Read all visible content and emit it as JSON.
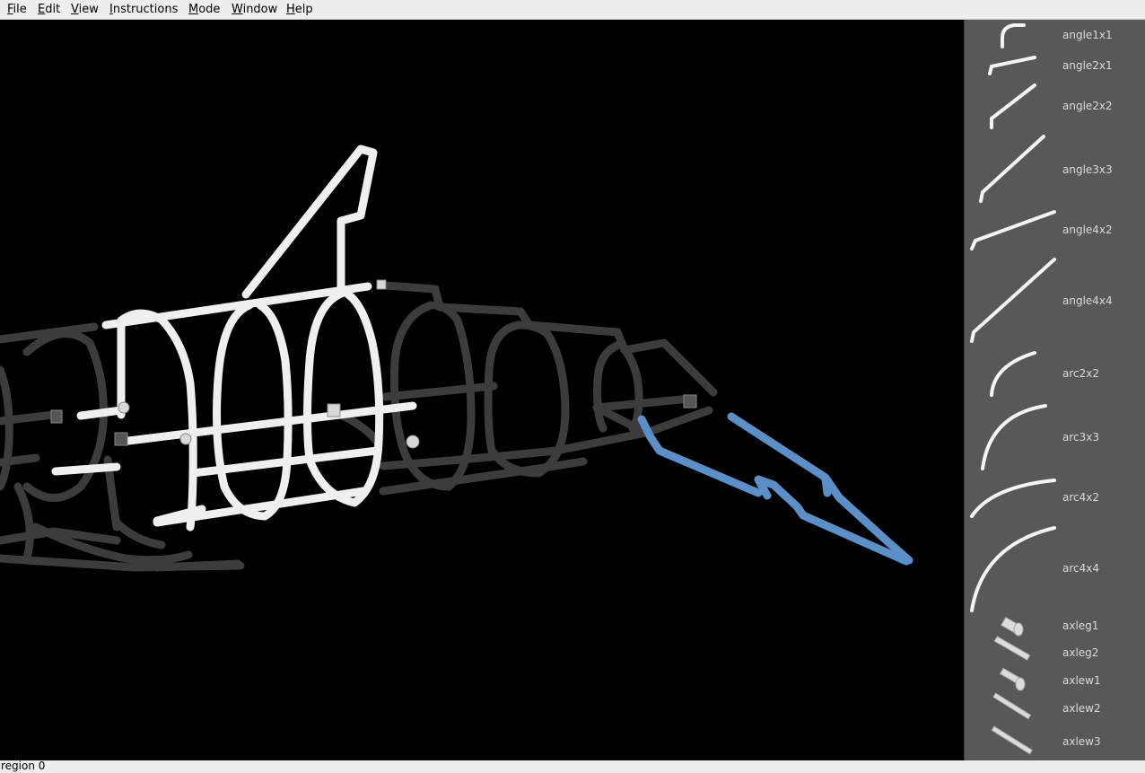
{
  "menu": {
    "items": [
      {
        "label": "File",
        "mnemonic": "F"
      },
      {
        "label": "Edit",
        "mnemonic": "E"
      },
      {
        "label": "View",
        "mnemonic": "V"
      },
      {
        "label": "Instructions",
        "mnemonic": "I"
      },
      {
        "label": "Mode",
        "mnemonic": "M"
      },
      {
        "label": "Window",
        "mnemonic": "W"
      },
      {
        "label": "Help",
        "mnemonic": "H"
      }
    ]
  },
  "palette": {
    "parts": [
      {
        "label": "angle1x1",
        "icon": "angle-part-icon"
      },
      {
        "label": "angle2x1",
        "icon": "angle-part-icon"
      },
      {
        "label": "angle2x2",
        "icon": "angle-part-icon"
      },
      {
        "label": "angle3x3",
        "icon": "angle-part-icon"
      },
      {
        "label": "angle4x2",
        "icon": "angle-part-icon"
      },
      {
        "label": "angle4x4",
        "icon": "angle-part-icon"
      },
      {
        "label": "arc2x2",
        "icon": "arc-part-icon"
      },
      {
        "label": "arc3x3",
        "icon": "arc-part-icon"
      },
      {
        "label": "arc4x2",
        "icon": "arc-part-icon"
      },
      {
        "label": "arc4x4",
        "icon": "arc-part-icon"
      },
      {
        "label": "axleg1",
        "icon": "axle-part-icon"
      },
      {
        "label": "axleg2",
        "icon": "axle-part-icon"
      },
      {
        "label": "axlew1",
        "icon": "axle-part-icon"
      },
      {
        "label": "axlew2",
        "icon": "axle-part-icon"
      },
      {
        "label": "axlew3",
        "icon": "axle-part-icon"
      }
    ]
  },
  "viewport": {
    "background": "#000000",
    "colors": {
      "selected": "#f0f0f0",
      "unselected": "#3c3c3c",
      "highlighted": "#5a8fc8"
    }
  },
  "status": {
    "text": "region 0"
  }
}
